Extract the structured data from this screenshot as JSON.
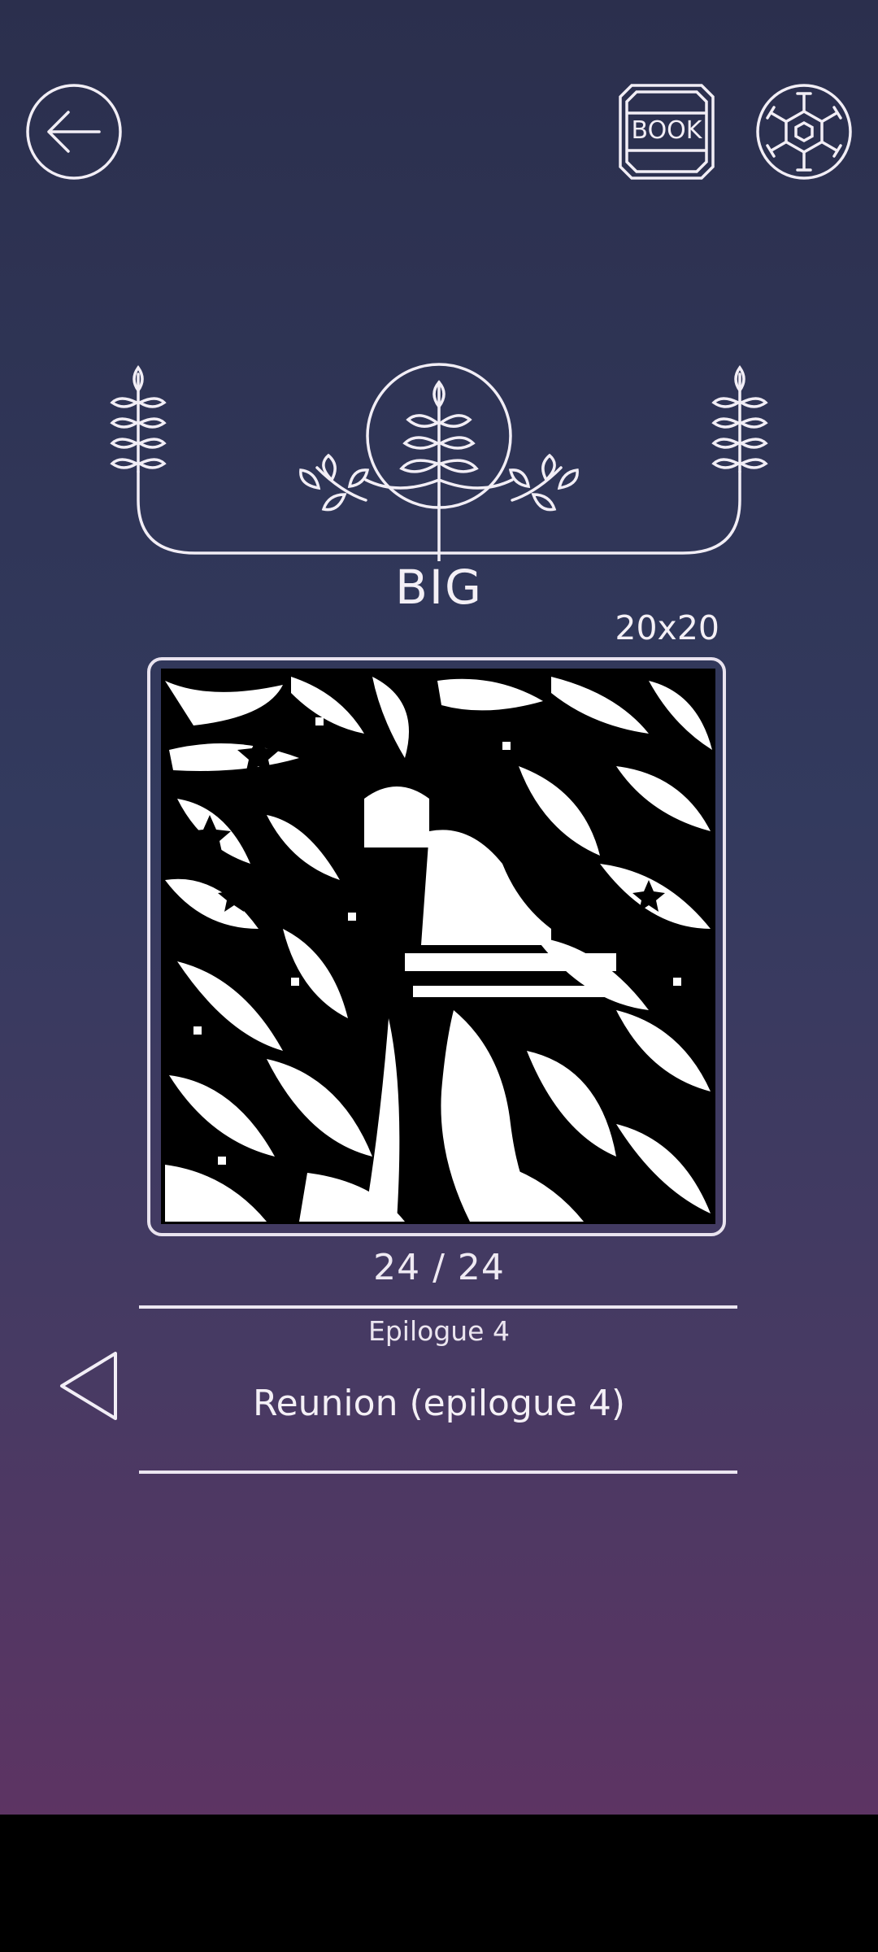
{
  "header": {
    "back_icon": "arrow-left-icon",
    "book_label": "BOOK",
    "settings_icon": "hexagon-gear-icon"
  },
  "level": {
    "emblem_icon": "laurel-branch-emblem-icon",
    "mode": "BIG",
    "grid_size": "20x20",
    "progress": "24 / 24",
    "chapter": "Epilogue 4",
    "stage_name": "Reunion (epilogue 4)"
  },
  "colors": {
    "bg_top": "#2b2f4d",
    "bg_bottom": "#5d3463",
    "line": "#ece6f1"
  }
}
